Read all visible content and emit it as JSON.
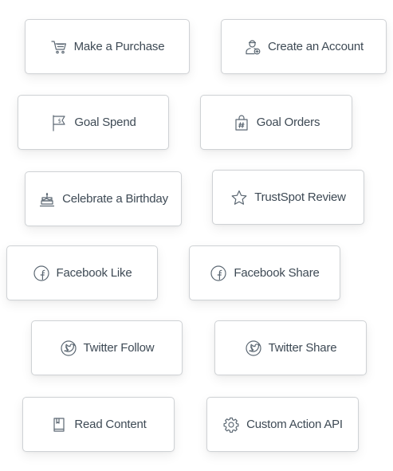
{
  "actions": [
    {
      "label": "Make a Purchase",
      "icon": "cart-icon"
    },
    {
      "label": "Create an Account",
      "icon": "add-user-icon"
    },
    {
      "label": "Goal Spend",
      "icon": "dollar-flag-icon"
    },
    {
      "label": "Goal Orders",
      "icon": "shopping-bag-hash-icon"
    },
    {
      "label": "Celebrate a Birthday",
      "icon": "birthday-cake-icon"
    },
    {
      "label": "TrustSpot Review",
      "icon": "star-icon"
    },
    {
      "label": "Facebook Like",
      "icon": "facebook-icon"
    },
    {
      "label": "Facebook Share",
      "icon": "facebook-icon"
    },
    {
      "label": "Twitter Follow",
      "icon": "twitter-icon"
    },
    {
      "label": "Twitter Share",
      "icon": "twitter-icon"
    },
    {
      "label": "Read Content",
      "icon": "book-icon"
    },
    {
      "label": "Custom Action API",
      "icon": "gear-icon"
    }
  ],
  "colors": {
    "text": "#3e4a55",
    "icon": "#5c6873",
    "border": "#cfd2d5",
    "background": "#ffffff"
  }
}
